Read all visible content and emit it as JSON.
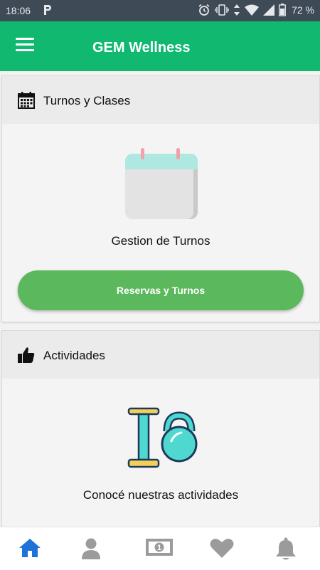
{
  "status_bar": {
    "time": "18:06",
    "battery": "72 %",
    "icons": [
      "parking-app-icon",
      "alarm-icon",
      "vibrate-icon",
      "data-arrows-icon",
      "wifi-icon",
      "signal-icon",
      "battery-icon"
    ]
  },
  "app_bar": {
    "title": "GEM Wellness",
    "menu_icon": "hamburger-menu-icon",
    "color": "#10b870"
  },
  "cards": [
    {
      "title": "Turnos y Clases",
      "icon": "calendar-icon",
      "illustration": "calendar-illustration",
      "label": "Gestion de Turnos",
      "button_label": "Reservas y Turnos",
      "button_color": "#5cb85c"
    },
    {
      "title": "Actividades",
      "icon": "thumbs-up-icon",
      "illustration": "dumbbell-kettlebell-illustration",
      "label": "Conocé nuestras actividades"
    }
  ],
  "bottom_nav": {
    "items": [
      {
        "icon": "home-icon",
        "active": true
      },
      {
        "icon": "user-icon",
        "active": false
      },
      {
        "icon": "money-icon",
        "active": false
      },
      {
        "icon": "heart-icon",
        "active": false
      },
      {
        "icon": "bell-icon",
        "active": false
      }
    ],
    "active_color": "#1e73d8",
    "inactive_color": "#9b9b9b"
  }
}
